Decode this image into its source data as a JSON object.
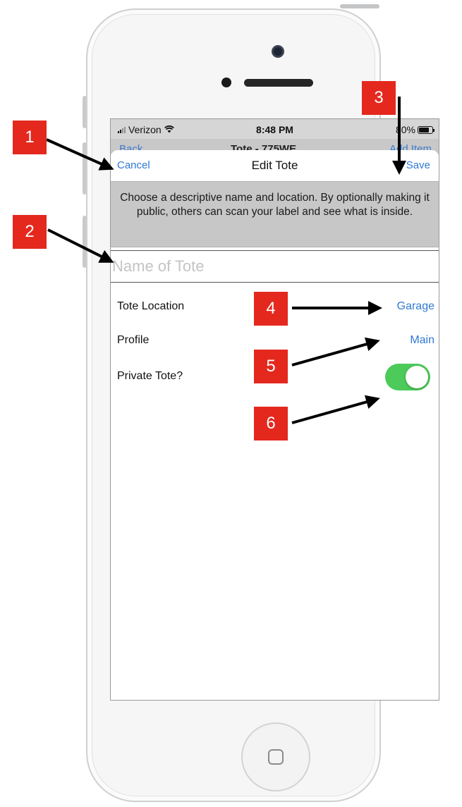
{
  "status_bar": {
    "carrier": "Verizon",
    "time": "8:48 PM",
    "battery": "80%"
  },
  "background_nav": {
    "back": "Back",
    "title": "Tote - 775WE",
    "add": "Add Item"
  },
  "nav": {
    "cancel": "Cancel",
    "title": "Edit Tote",
    "save": "Save"
  },
  "instructions": "Choose a descriptive name and location. By optionally making it public, others can scan your label and see what is inside.",
  "name_field": {
    "placeholder": "Name of Tote",
    "value": ""
  },
  "rows": {
    "location": {
      "label": "Tote Location",
      "value": "Garage"
    },
    "profile": {
      "label": "Profile",
      "value": "Main"
    },
    "private": {
      "label": "Private Tote?",
      "on": true
    }
  },
  "callouts": [
    "1",
    "2",
    "3",
    "4",
    "5",
    "6"
  ],
  "colors": {
    "accent": "#2f7ad2",
    "toggle_on": "#4cca5a",
    "callout": "#e4281e"
  }
}
